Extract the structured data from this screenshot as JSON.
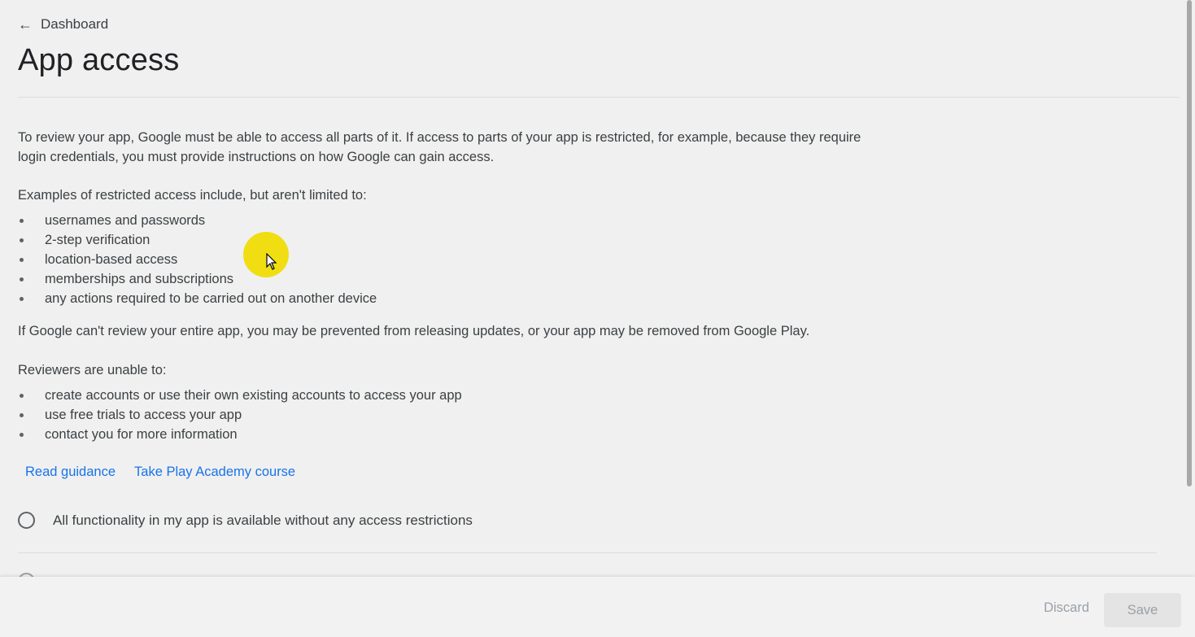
{
  "header": {
    "back_label": "Dashboard",
    "title": "App access"
  },
  "intro": {
    "text": "To review your app, Google must be able to access all parts of it. If access to parts of your app is restricted, for example, because they require login credentials, you must provide instructions on how Google can gain access."
  },
  "examples": {
    "heading": "Examples of restricted access include, but aren't limited to:",
    "items": [
      "usernames and passwords",
      "2-step verification",
      "location-based access",
      "memberships and subscriptions",
      "any actions required to be carried out on another device"
    ]
  },
  "warning": {
    "text": "If Google can't review your entire app, you may be prevented from releasing updates, or your app may be removed from Google Play."
  },
  "reviewers": {
    "heading": "Reviewers are unable to:",
    "items": [
      "create accounts or use their own existing accounts to access your app",
      "use free trials to access your app",
      "contact you for more information"
    ]
  },
  "links": {
    "read_guidance": "Read guidance",
    "play_academy": "Take Play Academy course"
  },
  "options": {
    "no_restrictions": "All functionality in my app is available without any access restrictions"
  },
  "footer": {
    "discard_label": "Discard",
    "save_label": "Save"
  },
  "colors": {
    "link": "#1a73e8",
    "background": "#f0f0f0",
    "text": "#3c4043",
    "cursor_highlight": "#f0dc00"
  },
  "icons": {
    "back": "arrow-left-icon",
    "radio": "radio-unchecked-icon",
    "cursor": "mouse-pointer-icon"
  }
}
